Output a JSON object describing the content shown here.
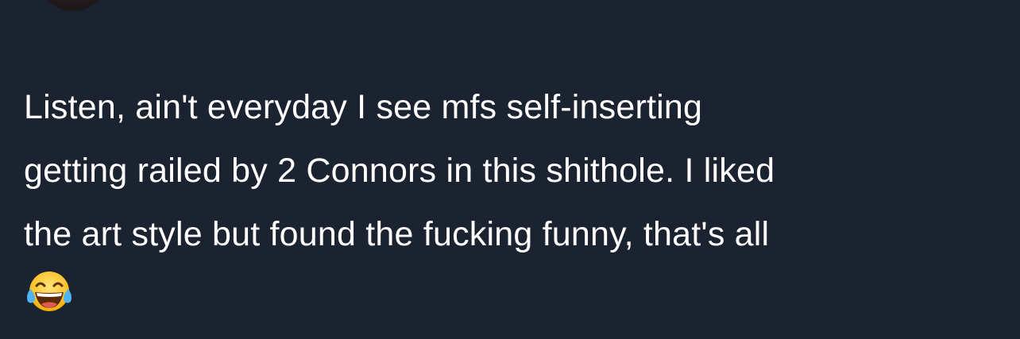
{
  "tweet": {
    "lines": [
      "Listen, ain't everyday I see mfs self-inserting",
      "getting railed by 2 Connors in this shithole. I liked",
      "the art style but found the fucking funny, that's all"
    ],
    "emoji_icon": "face-with-tears-of-joy-icon"
  },
  "colors": {
    "background": "#1b2230",
    "text": "#ffffff"
  }
}
